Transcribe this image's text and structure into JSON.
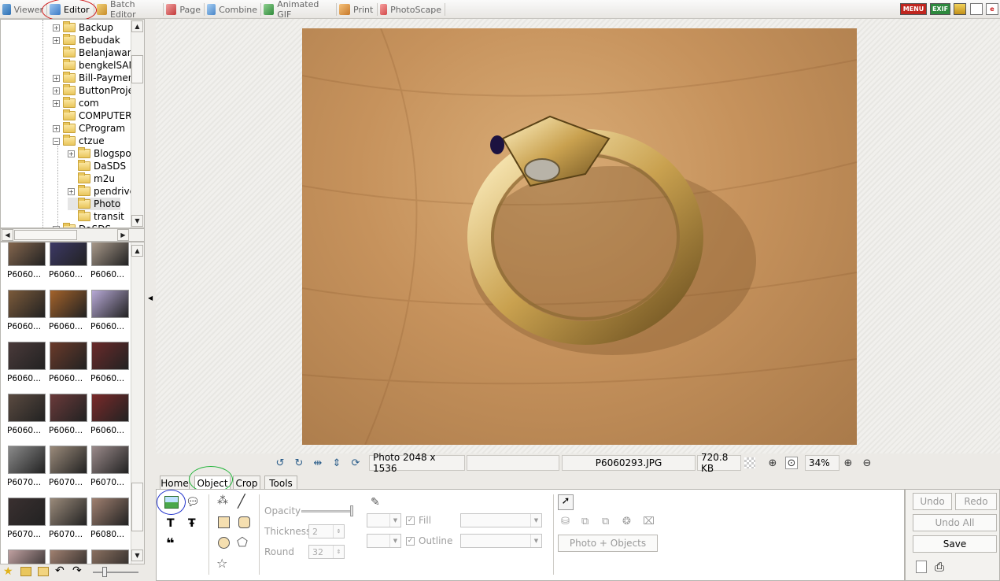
{
  "top_tabs": [
    {
      "label": "Viewer",
      "icon": "viewer-icon"
    },
    {
      "label": "Editor",
      "icon": "editor-icon"
    },
    {
      "label": "Batch Editor",
      "icon": "batch-editor-icon"
    },
    {
      "label": "Page",
      "icon": "page-icon"
    },
    {
      "label": "Combine",
      "icon": "combine-icon"
    },
    {
      "label": "Animated GIF",
      "icon": "animated-gif-icon"
    },
    {
      "label": "Print",
      "icon": "print-icon"
    },
    {
      "label": "PhotoScape",
      "icon": "photoscape-icon"
    }
  ],
  "top_right": {
    "menu": "MENU",
    "exif": "EXIF"
  },
  "tree": [
    {
      "label": "Backup",
      "expander": true,
      "level": 0
    },
    {
      "label": "Bebudak",
      "expander": true,
      "level": 0
    },
    {
      "label": "Belanjawan",
      "expander": false,
      "level": 0
    },
    {
      "label": "bengkelSAN",
      "expander": false,
      "level": 0
    },
    {
      "label": "Bill-Payment",
      "expander": true,
      "level": 0
    },
    {
      "label": "ButtonProje",
      "expander": true,
      "level": 0
    },
    {
      "label": "com",
      "expander": true,
      "level": 0
    },
    {
      "label": "COMPUTER-",
      "expander": false,
      "level": 0
    },
    {
      "label": "CProgram",
      "expander": true,
      "level": 0
    },
    {
      "label": "ctzue",
      "expander": "minus",
      "level": 0
    },
    {
      "label": "Blogspot",
      "expander": true,
      "level": 1
    },
    {
      "label": "DaSDS",
      "expander": false,
      "level": 1
    },
    {
      "label": "m2u",
      "expander": false,
      "level": 1
    },
    {
      "label": "pendrive",
      "expander": true,
      "level": 1
    },
    {
      "label": "Photo",
      "expander": false,
      "level": 1,
      "selected": true
    },
    {
      "label": "transit",
      "expander": false,
      "level": 1
    },
    {
      "label": "DaSDS",
      "expander": true,
      "level": 0
    }
  ],
  "thumbnails": [
    [
      "P6060...",
      "P6060...",
      "P6060..."
    ],
    [
      "P6060...",
      "P6060...",
      "P6060..."
    ],
    [
      "P6060...",
      "P6060...",
      "P6060..."
    ],
    [
      "P6060...",
      "P6060...",
      "P6060..."
    ],
    [
      "P6070...",
      "P6070...",
      "P6070..."
    ],
    [
      "P6070...",
      "P6070...",
      "P6080..."
    ],
    [
      "",
      "",
      ""
    ]
  ],
  "status": {
    "photo_size": "Photo 2048 x 1536",
    "empty_field": "",
    "filename": "P6060293.JPG",
    "filesize": "720.8 KB",
    "zoom": "34%"
  },
  "bottom_tabs": [
    "Home",
    "Object",
    "Crop",
    "Tools"
  ],
  "object_panel": {
    "opacity_label": "Opacity",
    "thickness_label": "Thickness",
    "thickness_value": "2",
    "round_label": "Round",
    "round_value": "32",
    "fill_label": "Fill",
    "outline_label": "Outline",
    "photo_objects_button": "Photo + Objects"
  },
  "right_panel": {
    "undo": "Undo",
    "redo": "Redo",
    "undo_all": "Undo All",
    "save": "Save"
  }
}
